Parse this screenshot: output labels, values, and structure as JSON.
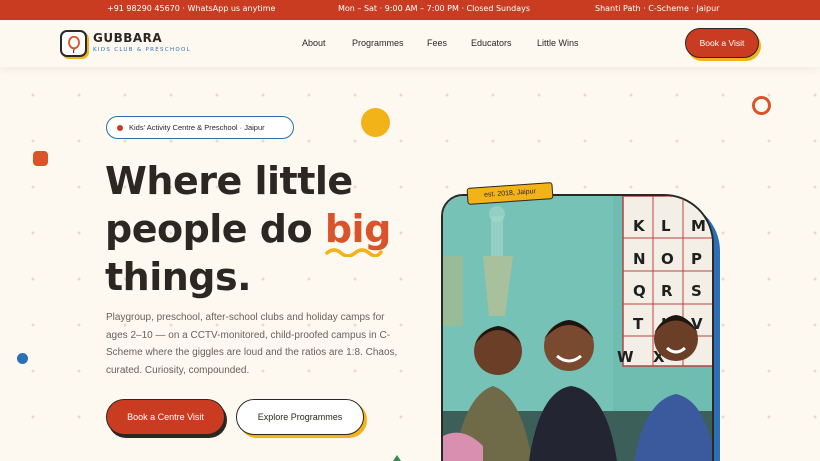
{
  "topbar": {
    "phone": "+91 98290 45670 · WhatsApp us anytime",
    "hours": "Mon – Sat · 9:00 AM – 7:00 PM · Closed Sundays",
    "address": "Shanti Path · C-Scheme · Jaipur"
  },
  "brand": {
    "name": "GUBBARA",
    "tagline": "KIDS CLUB & PRESCHOOL"
  },
  "nav": {
    "items": [
      {
        "label": "About"
      },
      {
        "label": "Programmes"
      },
      {
        "label": "Fees"
      },
      {
        "label": "Educators"
      },
      {
        "label": "Little Wins"
      }
    ],
    "cta": "Book a Visit"
  },
  "hero": {
    "badge": "Kids' Activity Centre & Preschool · Jaipur",
    "headline_line1": "Where little",
    "headline_line2_pre": "people do ",
    "headline_highlight": "big",
    "headline_line3": "things.",
    "description": "Playgroup, preschool, after-school clubs and holiday camps for ages 2–10 — on a CCTV-monitored, child-proofed campus in C-Scheme where the giggles are loud and the ratios are 1:8. Chaos, curated. Curiosity, compounded.",
    "primary_cta": "Book a Centre Visit",
    "secondary_cta": "Explore Programmes",
    "photo_tag": "est. 2018, Jaipur"
  },
  "colors": {
    "brand_red": "#c93c22",
    "accent_orange": "#d9542b",
    "accent_yellow": "#f2b319",
    "accent_blue": "#2a6fb7",
    "ink": "#2b2722",
    "background": "#fdf8f0"
  },
  "icons": {
    "logo": "balloon-icon"
  }
}
